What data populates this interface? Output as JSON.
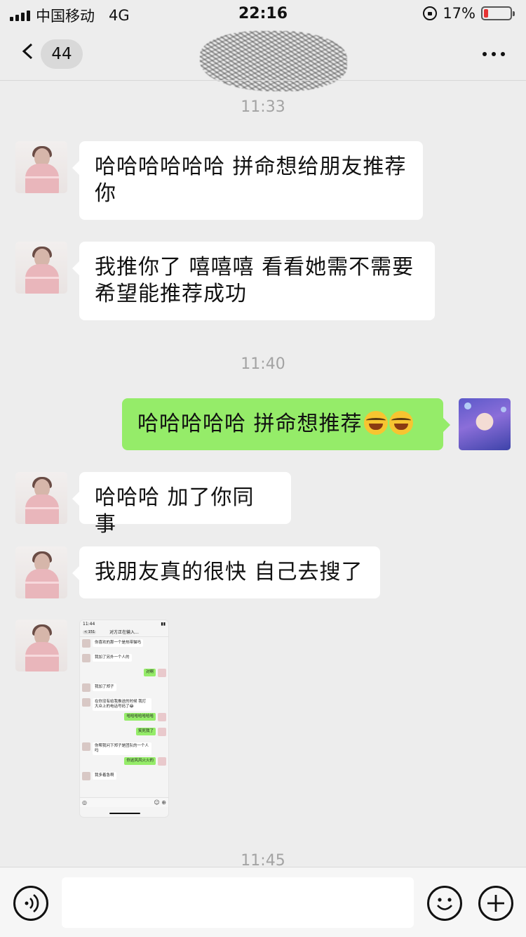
{
  "status_bar": {
    "carrier": "中国移动",
    "network": "4G",
    "time": "22:16",
    "battery_percent": "17%",
    "battery_level": 0.17
  },
  "nav": {
    "unread_count": "44"
  },
  "timestamps": [
    "11:33",
    "11:40",
    "11:45"
  ],
  "messages": [
    {
      "side": "left",
      "lines": [
        "哈哈哈哈哈哈 拼命想给朋友推荐",
        "你"
      ]
    },
    {
      "side": "left",
      "lines": [
        "我推你了 嘻嘻嘻 看看她需不需要",
        "希望能推荐成功"
      ]
    },
    {
      "side": "right",
      "text": "哈哈哈哈哈 拼命想推荐"
    },
    {
      "side": "left",
      "text": "哈哈哈 加了你同事"
    },
    {
      "side": "left",
      "text": "我朋友真的很快 自己去搜了"
    }
  ],
  "image_message": {
    "time": "11:44",
    "badge": "151",
    "title": "对方正在输入...",
    "rows": [
      {
        "side": "left",
        "text": "你喜欢的那一个是热带猫吗"
      },
      {
        "side": "left",
        "text": "我加了另外一个人的"
      },
      {
        "side": "right",
        "text": "对啊"
      },
      {
        "side": "left",
        "text": "我加了郑子"
      },
      {
        "side": "left",
        "text": "在你没有给我推送的时候 我打大众上的电话号码了😂"
      },
      {
        "side": "right",
        "text": "哈哈哈哈哈哈哈"
      },
      {
        "side": "right",
        "text": "笑死我了"
      },
      {
        "side": "left",
        "text": "你帮我问下郑子是团队的一个人吗"
      },
      {
        "side": "right",
        "text": "你这风风火火的"
      },
      {
        "side": "left",
        "text": "我多着急啊"
      }
    ]
  },
  "icons": {
    "back": "chevron-left-icon",
    "more": "more-dots-icon",
    "voice": "voice-icon",
    "emoji": "emoji-icon",
    "plus": "plus-icon"
  },
  "colors": {
    "self_bubble": "#95ec69",
    "other_bubble": "#ffffff",
    "background": "#ededed",
    "battery_low": "#e63333"
  }
}
